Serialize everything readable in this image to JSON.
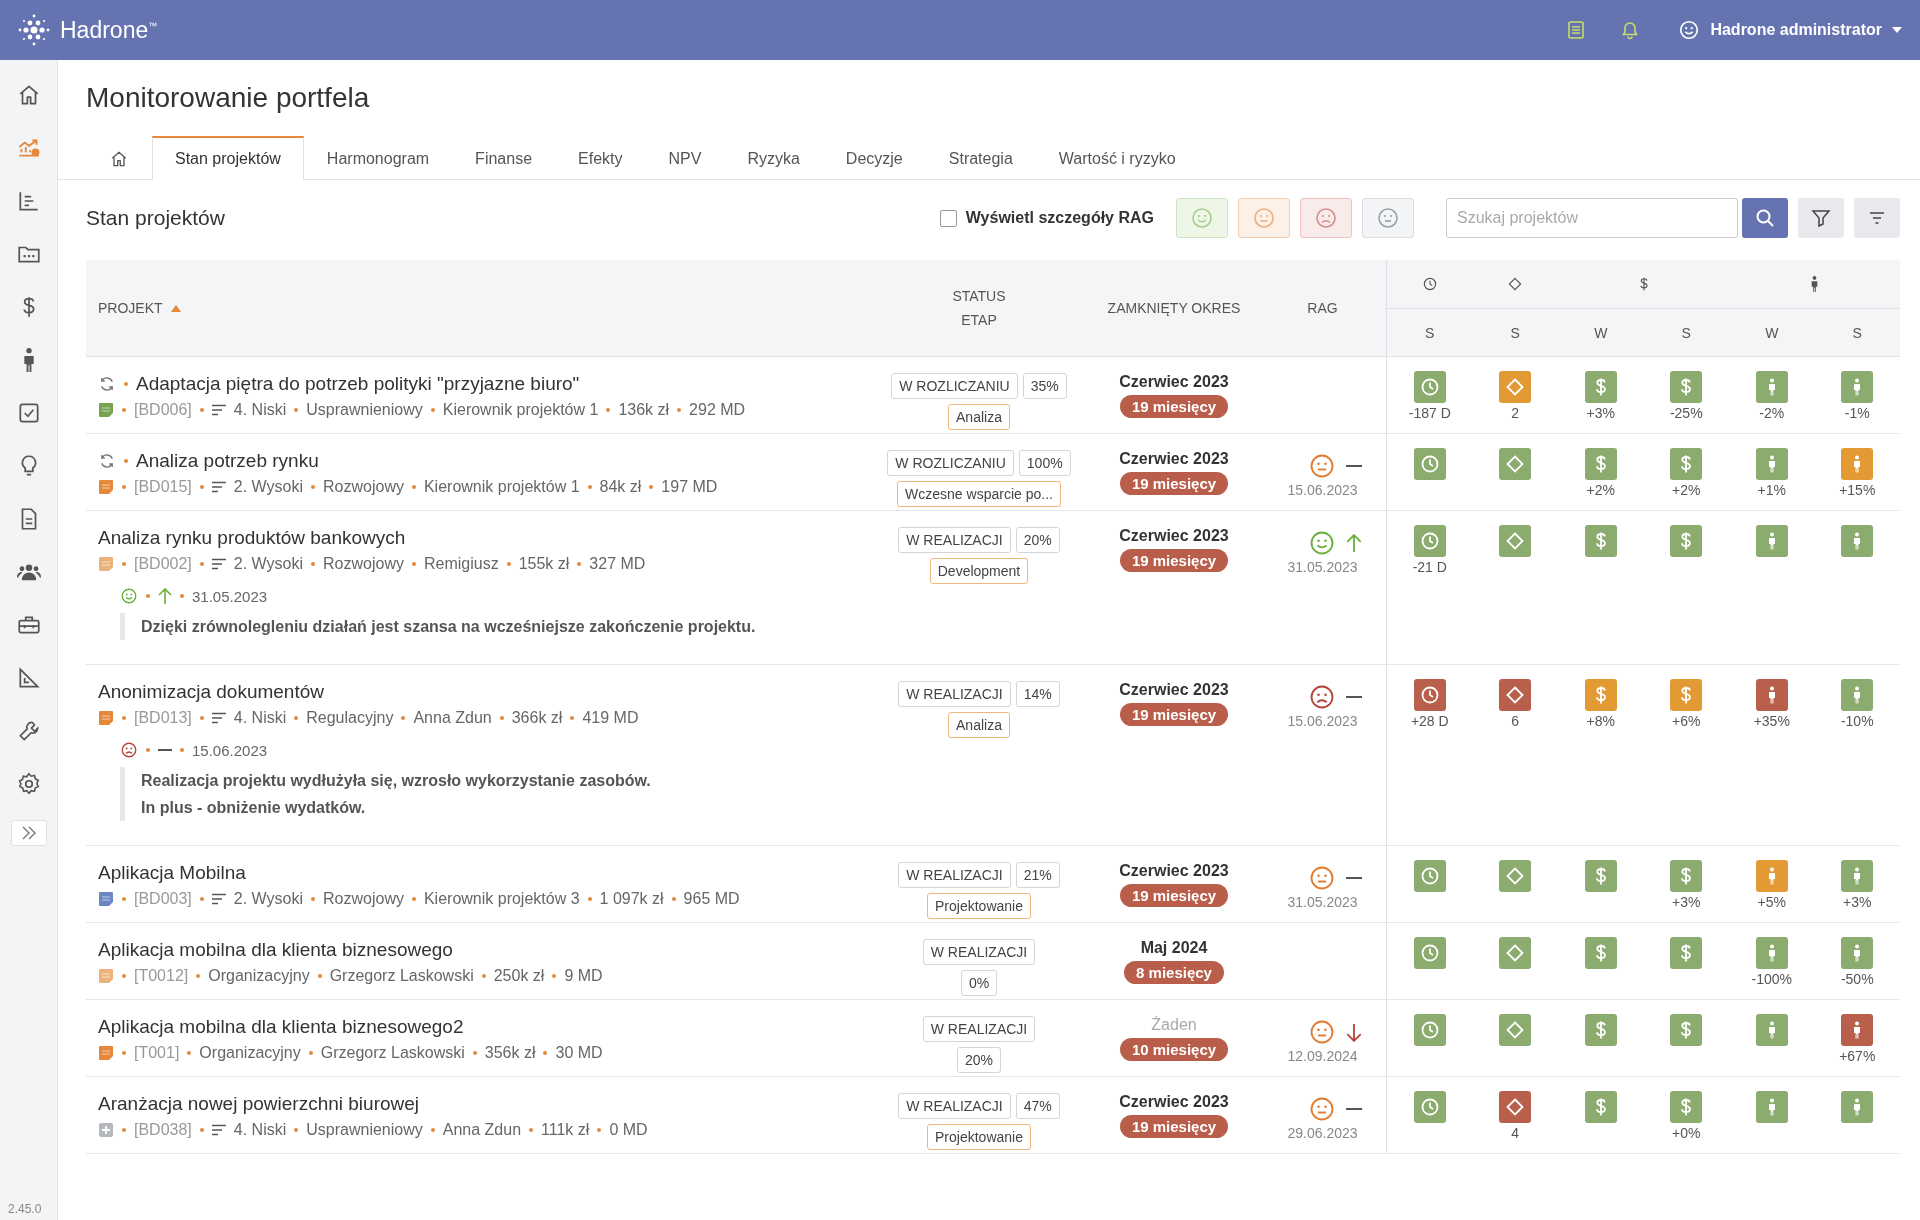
{
  "topbar": {
    "brand": "Hadrone$^{™}$",
    "user": "Hadrone administrator"
  },
  "sidebar": {
    "items": [
      {
        "kind": "home",
        "selected": false
      },
      {
        "kind": "portfolio",
        "selected": true
      },
      {
        "kind": "chart",
        "selected": false
      },
      {
        "kind": "folder",
        "selected": false
      },
      {
        "kind": "money",
        "selected": false
      },
      {
        "kind": "person",
        "selected": false
      },
      {
        "kind": "task",
        "selected": false
      },
      {
        "kind": "idea",
        "selected": false
      },
      {
        "kind": "document",
        "selected": false
      },
      {
        "kind": "team",
        "selected": false
      },
      {
        "kind": "toolbox",
        "selected": false
      },
      {
        "kind": "ruler",
        "selected": false
      },
      {
        "kind": "wrench",
        "selected": false
      },
      {
        "kind": "settings",
        "selected": false
      }
    ],
    "version": "2.45.0"
  },
  "page_title": "Monitorowanie portfela",
  "tabs": [
    {
      "kind": "home",
      "selected": false
    },
    {
      "kind": "text",
      "label": "Stan projektów",
      "selected": true
    },
    {
      "kind": "text",
      "label": "Harmonogram",
      "selected": false
    },
    {
      "kind": "text",
      "label": "Finanse",
      "selected": false
    },
    {
      "kind": "text",
      "label": "Efekty",
      "selected": false
    },
    {
      "kind": "text",
      "label": "NPV",
      "selected": false
    },
    {
      "kind": "text",
      "label": "Ryzyka",
      "selected": false
    },
    {
      "kind": "text",
      "label": "Decyzje",
      "selected": false
    },
    {
      "kind": "text",
      "label": "Strategia",
      "selected": false
    },
    {
      "kind": "text",
      "label": "Wartość i ryzyko",
      "selected": false
    }
  ],
  "toolbar": {
    "title": "Stan projektów",
    "rag_details": {
      "label": "Wyświetl szczegóły RAG",
      "checked": false
    },
    "rag_filters": [
      {
        "kind": "happy"
      },
      {
        "kind": "neutral"
      },
      {
        "kind": "sad"
      },
      {
        "kind": "none"
      }
    ],
    "search": {
      "placeholder": "Szukaj projektów"
    }
  },
  "table": {
    "columns": {
      "project": "PROJEKT",
      "status": "STATUS",
      "stage": "ETAP",
      "period": "ZAMKNIĘTY OKRES",
      "rag": "RAG"
    },
    "indicator_columns": [
      {
        "kind": "time",
        "label": "S"
      },
      {
        "kind": "scope",
        "label": "S"
      },
      {
        "kind": "cost",
        "label": "W"
      },
      {
        "kind": "cost",
        "label": "S"
      },
      {
        "kind": "people",
        "label": "W"
      },
      {
        "kind": "people",
        "label": "S"
      }
    ],
    "rows": [
      {
        "name": "Adaptacja piętra do potrzeb polityki \"przyjazne biuro\"",
        "sync": true,
        "icon": {
          "kind": "note",
          "color": "#78a34f"
        },
        "code": "[BD006]",
        "priority": "4. Niski",
        "type": "Usprawnieniowy",
        "manager": "Kierownik projektów 1",
        "budget": "136k zł",
        "effort": "292 MD",
        "status": "W ROZLICZANIU",
        "progress": "35%",
        "stage": "Analiza",
        "period": "Czerwiec 2023",
        "period_empty": false,
        "duration": "19 miesięcy",
        "indicators": [
          {
            "color": "#8cab6e",
            "value": "-187 D"
          },
          {
            "color": "#e39a35",
            "value": "2"
          },
          {
            "color": "#8cab6e",
            "value": "+3%"
          },
          {
            "color": "#8cab6e",
            "value": "-25%"
          },
          {
            "color": "#8cab6e",
            "value": "-2%"
          },
          {
            "color": "#8cab6e",
            "value": "-1%"
          }
        ]
      },
      {
        "name": "Analiza potrzeb rynku",
        "sync": true,
        "icon": {
          "kind": "note",
          "color": "#e5883a"
        },
        "code": "[BD015]",
        "priority": "2. Wysoki",
        "type": "Rozwojowy",
        "manager": "Kierownik projektów 1",
        "budget": "84k zł",
        "effort": "197 MD",
        "status": "W ROZLICZANIU",
        "progress": "100%",
        "stage": "Wczesne wsparcie po...",
        "period": "Czerwiec 2023",
        "period_empty": false,
        "duration": "19 miesięcy",
        "rag": {
          "kind": "neutral",
          "trend": {
            "kind": "flat"
          },
          "date": "15.06.2023"
        },
        "indicators": [
          {
            "color": "#8cab6e"
          },
          {
            "color": "#8cab6e"
          },
          {
            "color": "#8cab6e",
            "value": "+2%"
          },
          {
            "color": "#8cab6e",
            "value": "+2%"
          },
          {
            "color": "#8cab6e",
            "value": "+1%"
          },
          {
            "color": "#e39a35",
            "value": "+15%"
          }
        ]
      },
      {
        "name": "Analiza rynku produktów bankowych",
        "sync": false,
        "icon": {
          "kind": "note",
          "color": "#ebb27c"
        },
        "code": "[BD002]",
        "priority": "2. Wysoki",
        "type": "Rozwojowy",
        "manager": "Remigiusz",
        "budget": "155k zł",
        "effort": "327 MD",
        "status": "W REALIZACJI",
        "progress": "20%",
        "stage": "Development",
        "period": "Czerwiec 2023",
        "period_empty": false,
        "duration": "19 miesięcy",
        "rag": {
          "kind": "happy",
          "trend": {
            "kind": "up"
          },
          "date": "31.05.2023"
        },
        "comment": {
          "kind": "happy",
          "trend": {
            "kind": "up"
          },
          "date": "31.05.2023",
          "lines": [
            "Dzięki zrównolegleniu działań jest szansa na wcześniejsze zakończenie projektu."
          ]
        },
        "indicators": [
          {
            "color": "#8cab6e",
            "value": "-21 D"
          },
          {
            "color": "#8cab6e"
          },
          {
            "color": "#8cab6e"
          },
          {
            "color": "#8cab6e"
          },
          {
            "color": "#8cab6e"
          },
          {
            "color": "#8cab6e"
          }
        ]
      },
      {
        "name": "Anonimizacja dokumentów",
        "sync": false,
        "icon": {
          "kind": "note",
          "color": "#e5883a"
        },
        "code": "[BD013]",
        "priority": "4. Niski",
        "type": "Regulacyjny",
        "manager": "Anna Zdun",
        "budget": "366k zł",
        "effort": "419 MD",
        "status": "W REALIZACJI",
        "progress": "14%",
        "stage": "Analiza",
        "period": "Czerwiec 2023",
        "period_empty": false,
        "duration": "19 miesięcy",
        "rag": {
          "kind": "sad",
          "trend": {
            "kind": "flat"
          },
          "date": "15.06.2023"
        },
        "comment": {
          "kind": "sad",
          "trend": {
            "kind": "flat"
          },
          "date": "15.06.2023",
          "lines": [
            "Realizacja projektu wydłużyła się, wzrosło wykorzystanie zasobów.",
            "In plus - obniżenie wydatków."
          ]
        },
        "indicators": [
          {
            "color": "#b9604c",
            "value": "+28 D"
          },
          {
            "color": "#b9604c",
            "value": "6"
          },
          {
            "color": "#e39a35",
            "value": "+8%"
          },
          {
            "color": "#e39a35",
            "value": "+6%"
          },
          {
            "color": "#b9604c",
            "value": "+35%"
          },
          {
            "color": "#8cab6e",
            "value": "-10%"
          }
        ]
      },
      {
        "name": "Aplikacja Mobilna",
        "sync": false,
        "icon": {
          "kind": "note",
          "color": "#6b86c4"
        },
        "code": "[BD003]",
        "priority": "2. Wysoki",
        "type": "Rozwojowy",
        "manager": "Kierownik projektów 3",
        "budget": "1 097k zł",
        "effort": "965 MD",
        "status": "W REALIZACJI",
        "progress": "21%",
        "stage": "Projektowanie",
        "period": "Czerwiec 2023",
        "period_empty": false,
        "duration": "19 miesięcy",
        "rag": {
          "kind": "neutral",
          "trend": {
            "kind": "flat"
          },
          "date": "31.05.2023"
        },
        "indicators": [
          {
            "color": "#8cab6e"
          },
          {
            "color": "#8cab6e"
          },
          {
            "color": "#8cab6e"
          },
          {
            "color": "#8cab6e",
            "value": "+3%"
          },
          {
            "color": "#e39a35",
            "value": "+5%"
          },
          {
            "color": "#8cab6e",
            "value": "+3%"
          }
        ]
      },
      {
        "name": "Aplikacja mobilna dla klienta biznesowego",
        "sync": false,
        "icon": {
          "kind": "note",
          "color": "#ebb27c"
        },
        "code": "[T0012]",
        "type": "Organizacyjny",
        "manager": "Grzegorz Laskowski",
        "budget": "250k zł",
        "effort": "9 MD",
        "status": "W REALIZACJI",
        "progress": "0%",
        "period": "Maj 2024",
        "period_empty": false,
        "duration": "8 miesięcy",
        "indicators": [
          {
            "color": "#8cab6e"
          },
          {
            "color": "#8cab6e"
          },
          {
            "color": "#8cab6e"
          },
          {
            "color": "#8cab6e"
          },
          {
            "color": "#8cab6e",
            "value": "-100%"
          },
          {
            "color": "#8cab6e",
            "value": "-50%"
          }
        ]
      },
      {
        "name": "Aplikacja mobilna dla klienta biznesowego2",
        "sync": false,
        "icon": {
          "kind": "note",
          "color": "#e5883a"
        },
        "code": "[T001]",
        "type": "Organizacyjny",
        "manager": "Grzegorz Laskowski",
        "budget": "356k zł",
        "effort": "30 MD",
        "status": "W REALIZACJI",
        "progress": "20%",
        "period": "Żaden",
        "period_empty": true,
        "duration": "10 miesięcy",
        "rag": {
          "kind": "neutral",
          "trend": {
            "kind": "down"
          },
          "date": "12.09.2024"
        },
        "indicators": [
          {
            "color": "#8cab6e"
          },
          {
            "color": "#8cab6e"
          },
          {
            "color": "#8cab6e"
          },
          {
            "color": "#8cab6e"
          },
          {
            "color": "#8cab6e"
          },
          {
            "color": "#b9604c",
            "value": "+67%"
          }
        ]
      },
      {
        "name": "Aranżacja nowej powierzchni biurowej",
        "sync": false,
        "icon": {
          "kind": "new",
          "color": "#b5b8bd"
        },
        "code": "[BD038]",
        "priority": "4. Niski",
        "type": "Usprawnieniowy",
        "manager": "Anna Zdun",
        "budget": "111k zł",
        "effort": "0 MD",
        "status": "W REALIZACJI",
        "progress": "47%",
        "stage": "Projektowanie",
        "period": "Czerwiec 2023",
        "period_empty": false,
        "duration": "19 miesięcy",
        "rag": {
          "kind": "neutral",
          "trend": {
            "kind": "flat"
          },
          "date": "29.06.2023"
        },
        "indicators": [
          {
            "color": "#8cab6e"
          },
          {
            "color": "#b9604c",
            "value": "4"
          },
          {
            "color": "#8cab6e"
          },
          {
            "color": "#8cab6e",
            "value": "+0%"
          },
          {
            "color": "#8cab6e"
          },
          {
            "color": "#8cab6e"
          }
        ]
      }
    ]
  }
}
